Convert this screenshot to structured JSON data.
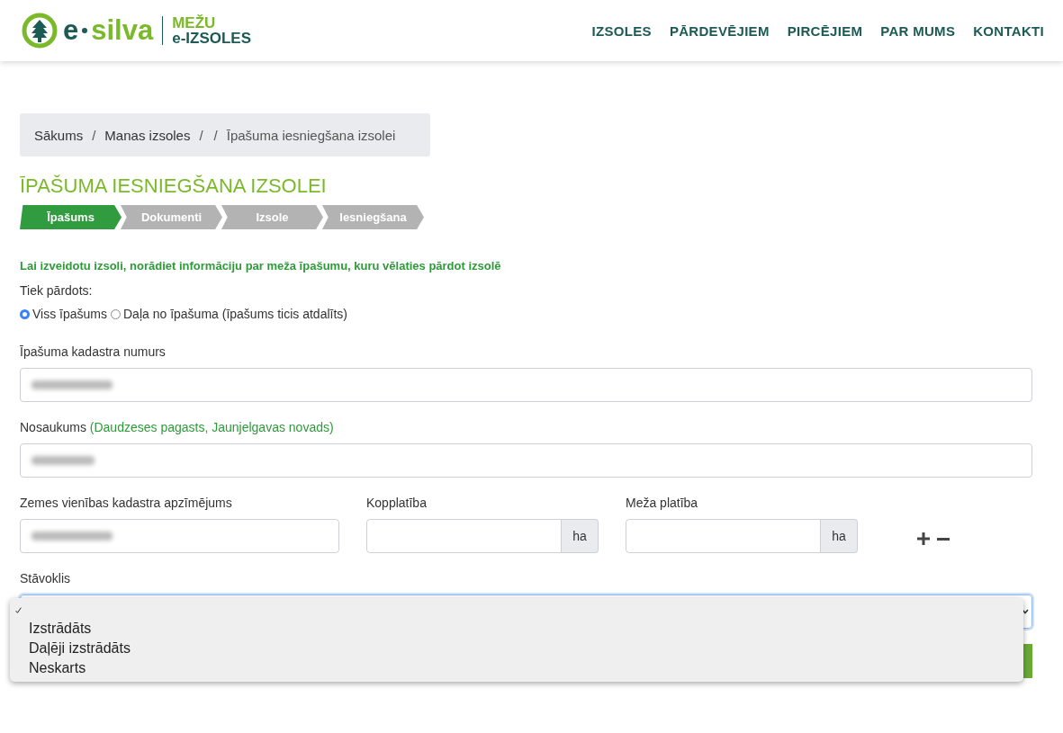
{
  "header": {
    "logo": {
      "prefix": "e",
      "name": "silva",
      "tagline_top": "MEŽU",
      "tagline_bottom": "e-IZSOLES"
    },
    "nav": [
      {
        "label": "IZSOLES"
      },
      {
        "label": "PĀRDEVĒJIEM"
      },
      {
        "label": "PIRCĒJIEM"
      },
      {
        "label": "PAR MUMS"
      },
      {
        "label": "KONTAKTI"
      }
    ]
  },
  "breadcrumb": [
    {
      "kind": "link",
      "label": "Sākums"
    },
    {
      "kind": "separator",
      "label": "/"
    },
    {
      "kind": "link",
      "label": "Manas izsoles"
    },
    {
      "kind": "separator",
      "label": "/"
    },
    {
      "kind": "separator",
      "label": "/"
    },
    {
      "kind": "current",
      "label": "Īpašuma iesniegšana izsolei"
    }
  ],
  "title": "ĪPAŠUMA IESNIEGŠANA IZSOLEI",
  "steps": [
    {
      "label": "Īpašums",
      "selected": true
    },
    {
      "label": "Dokumenti",
      "selected": false
    },
    {
      "label": "Izsole",
      "selected": false
    },
    {
      "label": "Iesniegšana",
      "selected": false
    }
  ],
  "intro": "Lai izveidotu izsoli, norādiet informāciju par meža īpašumu, kuru vēlaties pārdot izsolē",
  "sale_type": {
    "label": "Tiek pārdots:",
    "options": [
      {
        "label": "Viss īpašums",
        "selected": true
      },
      {
        "label": "Daļa no īpašuma (īpašums ticis atdalīts)",
        "selected": false
      }
    ]
  },
  "fields": {
    "cadastre_number": {
      "label": "Īpašuma kadastra numurs",
      "redacted": true
    },
    "name": {
      "label": "Nosaukums",
      "hint": "(Daudzeses pagasts, Jaunjelgavas novads)",
      "redacted": true
    },
    "land_unit": {
      "label": "Zemes vienības kadastra apzīmējums",
      "redacted": true
    },
    "total_area": {
      "label": "Kopplatība",
      "unit": "ha"
    },
    "forest_area": {
      "label": "Meža platība",
      "unit": "ha"
    },
    "state": {
      "label": "Stāvoklis",
      "expanded": true,
      "options": [
        {
          "selected": true
        },
        {
          "label": "Izstrādāts",
          "selected": false
        },
        {
          "label": "Daļēji izstrādāts",
          "selected": false
        },
        {
          "label": "Neskarts",
          "selected": false
        }
      ]
    }
  }
}
